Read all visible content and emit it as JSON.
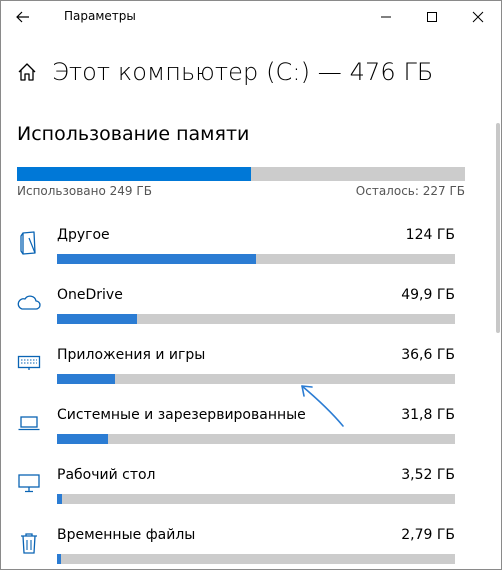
{
  "window": {
    "title": "Параметры"
  },
  "header": {
    "title": "Этот компьютер (C:) — 476 ГБ"
  },
  "storage": {
    "section_title": "Использование памяти",
    "used_label": "Использовано 249 ГБ",
    "free_label": "Осталось: 227 ГБ",
    "used_fraction": 0.523
  },
  "categories": [
    {
      "label": "Другое",
      "size": "124 ГБ",
      "fraction": 0.5,
      "icon": "other-file-icon"
    },
    {
      "label": "OneDrive",
      "size": "49,9 ГБ",
      "fraction": 0.2,
      "icon": "cloud-icon"
    },
    {
      "label": "Приложения и игры",
      "size": "36,6 ГБ",
      "fraction": 0.145,
      "icon": "keyboard-icon"
    },
    {
      "label": "Системные и зарезервированные",
      "size": "31,8 ГБ",
      "fraction": 0.127,
      "icon": "laptop-icon"
    },
    {
      "label": "Рабочий стол",
      "size": "3,52 ГБ",
      "fraction": 0.013,
      "icon": "monitor-icon"
    },
    {
      "label": "Временные файлы",
      "size": "2,79 ГБ",
      "fraction": 0.011,
      "icon": "trash-icon"
    }
  ],
  "colors": {
    "accent": "#0078d7",
    "track": "#cccccc",
    "annotation": "#2b7cd3"
  }
}
